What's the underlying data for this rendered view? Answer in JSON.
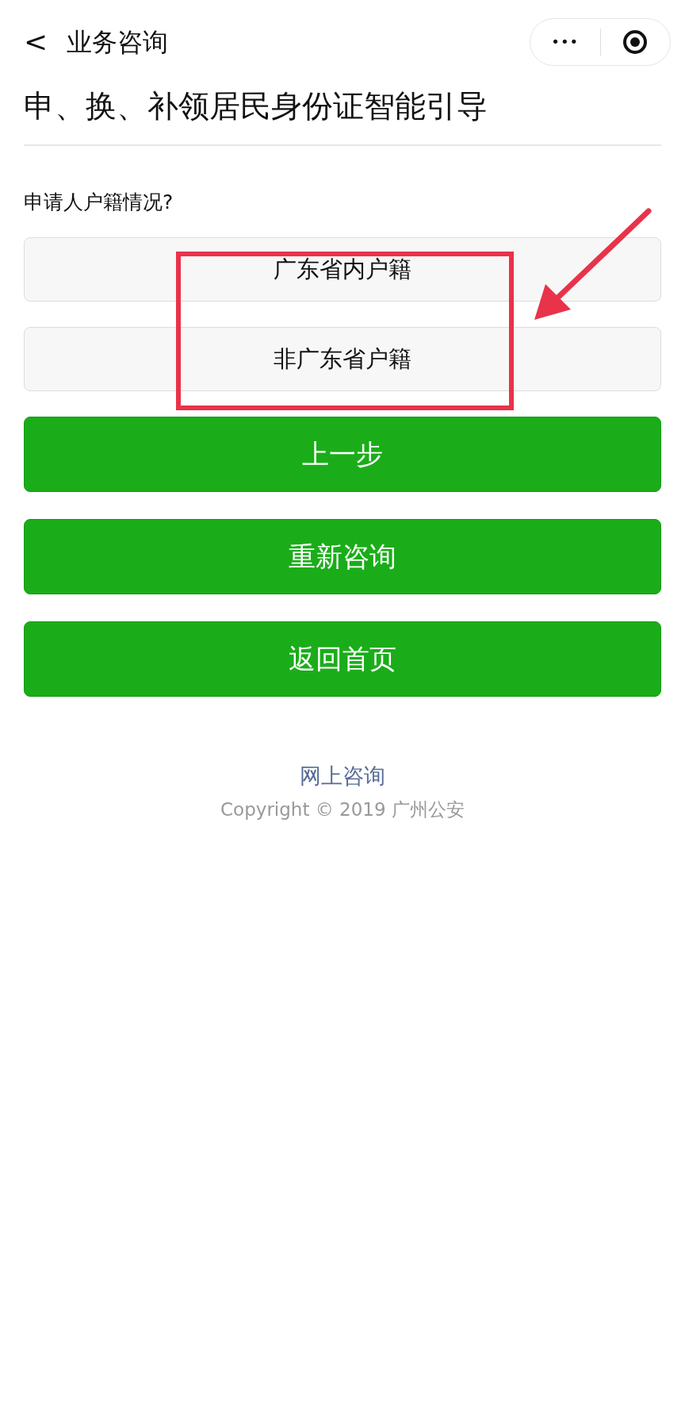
{
  "nav": {
    "back": "<",
    "title": "业务咨询",
    "more": "•••"
  },
  "heading": "申、换、补领居民身份证智能引导",
  "question": "申请人户籍情况?",
  "options": [
    {
      "label": "广东省内户籍"
    },
    {
      "label": "非广东省户籍"
    }
  ],
  "actions": [
    {
      "label": "上一步"
    },
    {
      "label": "重新咨询"
    },
    {
      "label": "返回首页"
    }
  ],
  "footer": {
    "link": "网上咨询",
    "copyright": "Copyright © 2019 广州公安"
  }
}
